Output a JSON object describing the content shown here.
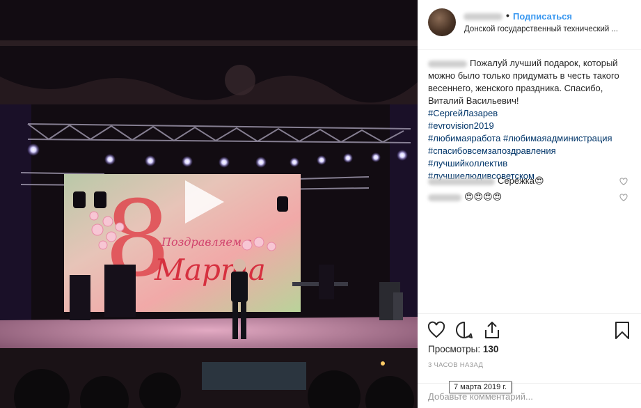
{
  "post": {
    "follow_label": "Подписаться",
    "separator": "•",
    "location": "Донской государственный технический ...",
    "caption_text": "Пожалуй лучший подарок, который можно было только придумать в честь такого весеннего, женского праздника. Спасибо, Виталий Васильевич!",
    "hashtags": [
      "#СергейЛазарев",
      "#evrovision2019",
      "#любимаяработа",
      "#любимаяадминистрация",
      "#спасибовсемзапоздравления",
      "#лучшийколлектив",
      "#лучшиелюдивсоветском"
    ]
  },
  "comments": [
    {
      "text": "Серёжка😍"
    },
    {
      "text": "😍😍😍😍"
    }
  ],
  "stats": {
    "views_label": "Просмотры:",
    "views_count": "130",
    "time_ago": "3 часов назад",
    "date_tooltip": "7 марта 2019 г."
  },
  "add_comment": {
    "placeholder": "Добавьте комментарий..."
  },
  "video": {
    "screen_text_1": "Поздравляем с",
    "screen_text_2": "Марта",
    "screen_digit": "8"
  },
  "icons": {
    "play": "play-icon",
    "like": "heart-icon",
    "comment": "comment-icon",
    "share": "share-icon",
    "save": "bookmark-icon"
  },
  "colors": {
    "accent": "#3897f0",
    "hashtag": "#003569",
    "muted": "#999999"
  }
}
